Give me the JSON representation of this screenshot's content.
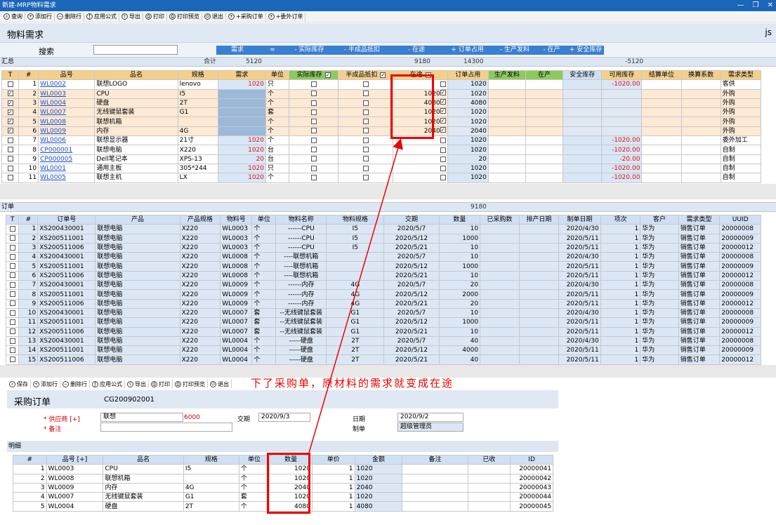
{
  "window": {
    "title": "新建-MRP物料需求"
  },
  "toolbar": [
    "查询",
    "添加行",
    "删除行",
    "应用公式",
    "导出",
    "打印",
    "打印预览",
    "退出",
    "+采购订单",
    "+委外订单"
  ],
  "main": {
    "title": "物料需求",
    "user": "js",
    "search_label": "搜索",
    "search_value": ""
  },
  "formula": [
    "需求",
    "=",
    "- 实际库存",
    "- 半成品抵扣",
    "- 在途",
    "+ 订单占用",
    "- 生产发料",
    "- 在产",
    "+ 安全库存"
  ],
  "summary": {
    "label": "汇总",
    "total_label": "合计",
    "demand": "5120",
    "onway": "9180",
    "order": "14300",
    "avail": "-5120"
  },
  "req_columns": [
    "T",
    "#",
    "品号",
    "品名",
    "规格",
    "需求",
    "单位",
    "实际库存",
    "半成品抵扣",
    "在途",
    "订单占用",
    "生产发料",
    "在产",
    "安全库存",
    "可用库存",
    "结算单位",
    "换算系数",
    "需求类型"
  ],
  "req_rows": [
    {
      "chk": "",
      "n": "1",
      "code": "WL0002",
      "name": "联想LOGO",
      "spec": "lenovo",
      "demand": "1020",
      "unit": "只",
      "onway": "",
      "order": "1020",
      "avail": "-1020.00",
      "type": "客供",
      "hl": false
    },
    {
      "chk": "☑",
      "n": "2",
      "code": "WL0003",
      "name": "CPU",
      "spec": "I5",
      "demand": "",
      "unit": "个",
      "onway": "1020",
      "order": "1020",
      "avail": "",
      "type": "外购",
      "hl": true
    },
    {
      "chk": "☑",
      "n": "3",
      "code": "WL0004",
      "name": "硬盘",
      "spec": "2T",
      "demand": "",
      "unit": "个",
      "onway": "4080",
      "order": "4080",
      "avail": "",
      "type": "外购",
      "hl": true
    },
    {
      "chk": "☑",
      "n": "4",
      "code": "WL0007",
      "name": "无线键鼠套装",
      "spec": "G1",
      "demand": "",
      "unit": "套",
      "onway": "1020",
      "order": "1020",
      "avail": "",
      "type": "外购",
      "hl": true
    },
    {
      "chk": "☑",
      "n": "5",
      "code": "WL0008",
      "name": "联想机箱",
      "spec": "",
      "demand": "",
      "unit": "个",
      "onway": "1020",
      "order": "1020",
      "avail": "",
      "type": "外购",
      "hl": true
    },
    {
      "chk": "☑",
      "n": "6",
      "code": "WL0009",
      "name": "内存",
      "spec": "4G",
      "demand": "",
      "unit": "个",
      "onway": "2040",
      "order": "2040",
      "avail": "",
      "type": "外购",
      "hl": true
    },
    {
      "chk": "",
      "n": "7",
      "code": "WL0006",
      "name": "联想显示器",
      "spec": "21寸",
      "demand": "1020",
      "unit": "个",
      "onway": "",
      "order": "1020",
      "avail": "-1020.00",
      "type": "委外加工",
      "hl": false
    },
    {
      "chk": "",
      "n": "8",
      "code": "CP000001",
      "name": "联想电脑",
      "spec": "X220",
      "demand": "1020",
      "unit": "台",
      "onway": "",
      "order": "1020",
      "avail": "-1020.00",
      "type": "自制",
      "hl": false
    },
    {
      "chk": "",
      "n": "9",
      "code": "CP000005",
      "name": "Dell笔记本",
      "spec": "XPS-13",
      "demand": "20",
      "unit": "台",
      "onway": "",
      "order": "20",
      "avail": "-20.00",
      "type": "自制",
      "hl": false
    },
    {
      "chk": "",
      "n": "10",
      "code": "WL0001",
      "name": "通用主板",
      "spec": "305*244",
      "demand": "1020",
      "unit": "只",
      "onway": "",
      "order": "1020",
      "avail": "-1020.00",
      "type": "自制",
      "hl": false
    },
    {
      "chk": "",
      "n": "11",
      "code": "WL0005",
      "name": "联想主机",
      "spec": "LX",
      "demand": "1020",
      "unit": "个",
      "onway": "",
      "order": "1020",
      "avail": "-1020.00",
      "type": "自制",
      "hl": false
    }
  ],
  "orders": {
    "label": "订单",
    "total": "9180",
    "columns": [
      "T",
      "#",
      "订单号",
      "产品",
      "产品规格",
      "物料号",
      "单位",
      "物料名称",
      "物料规格",
      "交期",
      "数量",
      "已采购数",
      "排产日期",
      "制单日期",
      "项次",
      "客户",
      "需求类型",
      "UUID"
    ],
    "rows": [
      [
        "1",
        "XS200430001",
        "联想电脑",
        "X220",
        "WL0003",
        "个",
        "------CPU",
        "I5",
        "2020/5/7",
        "10",
        "",
        "",
        "2020/4/30",
        "1",
        "华为",
        "销售订单",
        "20000008"
      ],
      [
        "2",
        "XS200511001",
        "联想电脑",
        "X220",
        "WL0003",
        "个",
        "------CPU",
        "I5",
        "2020/5/12",
        "1000",
        "",
        "",
        "2020/5/11",
        "1",
        "华为",
        "销售订单",
        "20000009"
      ],
      [
        "3",
        "XS200511006",
        "联想电脑",
        "X220",
        "WL0003",
        "个",
        "------CPU",
        "I5",
        "2020/5/21",
        "10",
        "",
        "",
        "2020/5/11",
        "1",
        "华为",
        "销售订单",
        "20000012"
      ],
      [
        "4",
        "XS200430001",
        "联想电脑",
        "X220",
        "WL0008",
        "个",
        "----联想机箱",
        "",
        "2020/5/7",
        "10",
        "",
        "",
        "2020/4/30",
        "1",
        "华为",
        "销售订单",
        "20000008"
      ],
      [
        "5",
        "XS200511001",
        "联想电脑",
        "X220",
        "WL0008",
        "个",
        "----联想机箱",
        "",
        "2020/5/12",
        "1000",
        "",
        "",
        "2020/5/11",
        "1",
        "华为",
        "销售订单",
        "20000009"
      ],
      [
        "6",
        "XS200511006",
        "联想电脑",
        "X220",
        "WL0008",
        "个",
        "----联想机箱",
        "",
        "2020/5/21",
        "10",
        "",
        "",
        "2020/5/11",
        "1",
        "华为",
        "销售订单",
        "20000012"
      ],
      [
        "7",
        "XS200430001",
        "联想电脑",
        "X220",
        "WL0009",
        "个",
        "------内存",
        "4G",
        "2020/5/7",
        "20",
        "",
        "",
        "2020/4/30",
        "1",
        "华为",
        "销售订单",
        "20000008"
      ],
      [
        "8",
        "XS200511001",
        "联想电脑",
        "X220",
        "WL0009",
        "个",
        "------内存",
        "4G",
        "2020/5/12",
        "2000",
        "",
        "",
        "2020/5/11",
        "1",
        "华为",
        "销售订单",
        "20000009"
      ],
      [
        "9",
        "XS200511006",
        "联想电脑",
        "X220",
        "WL0009",
        "个",
        "------内存",
        "4G",
        "2020/5/21",
        "20",
        "",
        "",
        "2020/5/11",
        "1",
        "华为",
        "销售订单",
        "20000012"
      ],
      [
        "10",
        "XS200430001",
        "联想电脑",
        "X220",
        "WL0007",
        "套",
        "--无线键鼠套装",
        "G1",
        "2020/5/7",
        "10",
        "",
        "",
        "2020/4/30",
        "1",
        "华为",
        "销售订单",
        "20000008"
      ],
      [
        "11",
        "XS200511001",
        "联想电脑",
        "X220",
        "WL0007",
        "套",
        "--无线键鼠套装",
        "G1",
        "2020/5/12",
        "1000",
        "",
        "",
        "2020/5/11",
        "1",
        "华为",
        "销售订单",
        "20000009"
      ],
      [
        "12",
        "XS200511006",
        "联想电脑",
        "X220",
        "WL0007",
        "套",
        "--无线键鼠套装",
        "G1",
        "2020/5/21",
        "10",
        "",
        "",
        "2020/5/11",
        "1",
        "华为",
        "销售订单",
        "20000012"
      ],
      [
        "13",
        "XS200430001",
        "联想电脑",
        "X220",
        "WL0004",
        "个",
        "-----硬盘",
        "2T",
        "2020/5/7",
        "40",
        "",
        "",
        "2020/4/30",
        "1",
        "华为",
        "销售订单",
        "20000008"
      ],
      [
        "14",
        "XS200511001",
        "联想电脑",
        "X220",
        "WL0004",
        "个",
        "-----硬盘",
        "2T",
        "2020/5/12",
        "4000",
        "",
        "",
        "2020/5/11",
        "1",
        "华为",
        "销售订单",
        "20000009"
      ],
      [
        "15",
        "XS200511006",
        "联想电脑",
        "X220",
        "WL0004",
        "个",
        "-----硬盘",
        "2T",
        "2020/5/21",
        "40",
        "",
        "",
        "2020/5/11",
        "1",
        "华为",
        "销售订单",
        "20000012"
      ]
    ]
  },
  "annotation": "下了采购单，原材料的需求就变成在途",
  "po": {
    "toolbar": [
      "保存",
      "添加行",
      "删除行",
      "应用公式",
      "导出",
      "打印",
      "打印预览",
      "退出"
    ],
    "title": "采购订单",
    "number": "CG200902001",
    "supplier_label": "* 供应商 [+]",
    "supplier": "联想",
    "supplier_code": "6000",
    "remark_label": "* 备注",
    "due_label": "交期",
    "due": "2020/9/3",
    "date_label": "日期",
    "date": "2020/9/2",
    "maker_label": "制单",
    "maker": "超级管理员",
    "detail_label": "明细",
    "columns": [
      "#",
      "品号 [+]",
      "品名",
      "规格",
      "单位",
      "数量",
      "单价",
      "金额",
      "备注",
      "已收",
      "ID"
    ],
    "rows": [
      [
        "1",
        "WL0003",
        "CPU",
        "I5",
        "个",
        "1020",
        "1",
        "1020",
        "",
        "",
        "20000041"
      ],
      [
        "2",
        "WL0008",
        "联想机箱",
        "",
        "个",
        "1020",
        "1",
        "1020",
        "",
        "",
        "20000042"
      ],
      [
        "3",
        "WL0009",
        "内存",
        "4G",
        "个",
        "2040",
        "1",
        "2040",
        "",
        "",
        "20000043"
      ],
      [
        "4",
        "WL0007",
        "无线键鼠套装",
        "G1",
        "套",
        "1020",
        "1",
        "1020",
        "",
        "",
        "20000044"
      ],
      [
        "5",
        "WL0004",
        "硬盘",
        "2T",
        "个",
        "4080",
        "1",
        "4080",
        "",
        "",
        "20000045"
      ]
    ]
  },
  "colors": {
    "title_bar": "#1a66b8",
    "header_orange": "#f4cf8a",
    "header_green": "#8dca5c",
    "annotation_red": "#ee0000"
  }
}
